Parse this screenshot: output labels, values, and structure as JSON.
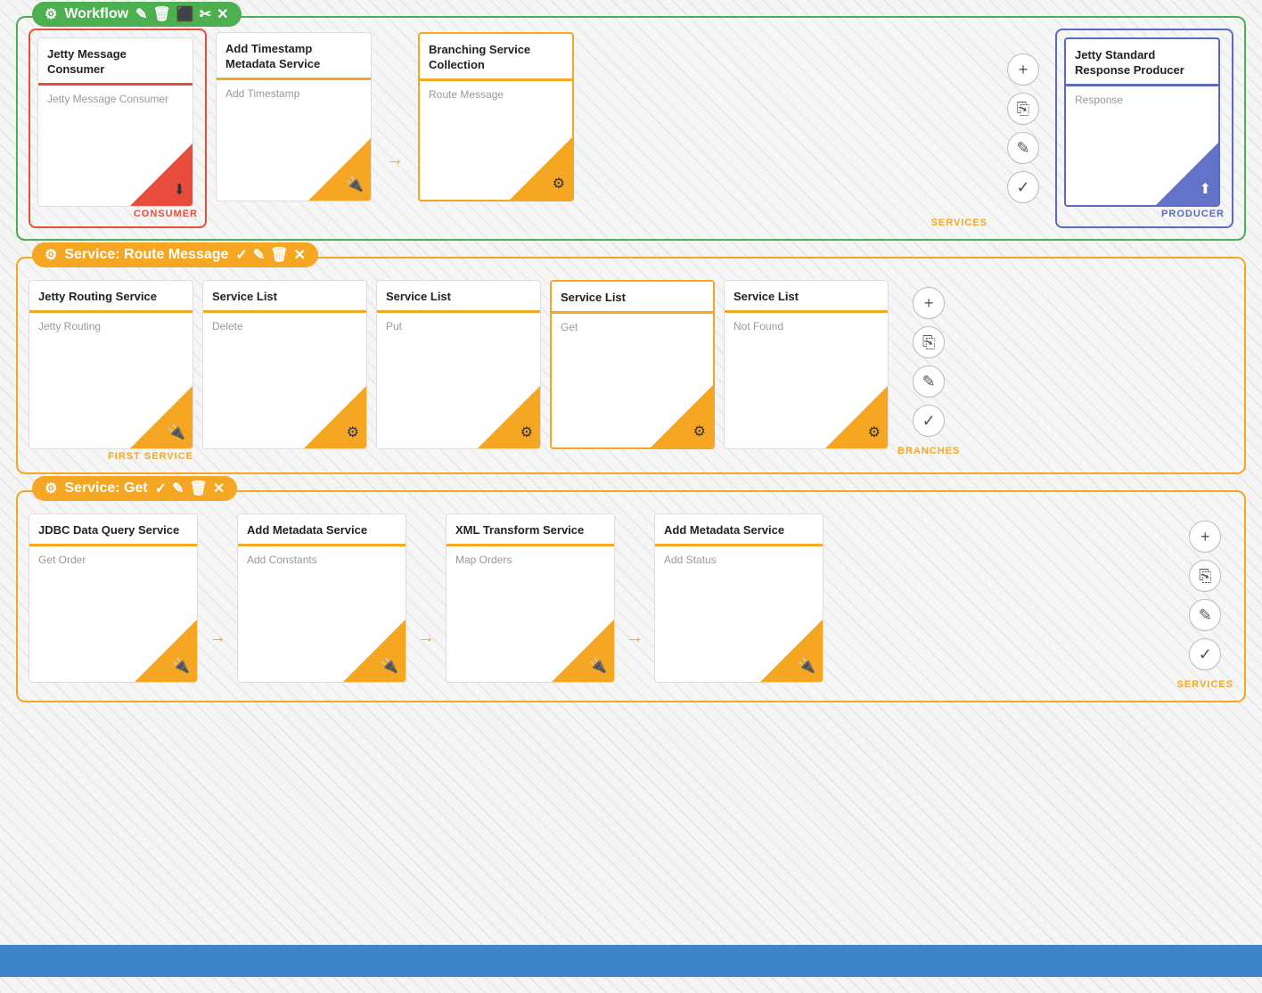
{
  "workflow": {
    "header_icon": "⚙",
    "title": "Workflow",
    "actions": [
      "✎",
      "🗑",
      "⬛",
      "✂",
      "✕"
    ],
    "consumer": {
      "label": "CONSUMER",
      "card_title": "Jetty Message Consumer",
      "card_subtitle": "Jetty Message Consumer"
    },
    "services": {
      "label": "SERVICES",
      "cards": [
        {
          "title": "Add Timestamp Metadata Service",
          "subtitle": "Add Timestamp"
        },
        {
          "title": "Branching Service Collection",
          "subtitle": "Route Message",
          "selected": true
        }
      ]
    },
    "producer": {
      "label": "PRODUCER",
      "card_title": "Jetty Standard Response Producer",
      "card_subtitle": "Response"
    }
  },
  "route_message": {
    "header_title": "Service: Route Message",
    "label": "BRANCHES",
    "first_label": "FIRST SERVICE",
    "cards": [
      {
        "title": "Jetty Routing Service",
        "subtitle": "Jetty Routing",
        "first": true
      },
      {
        "title": "Service List",
        "subtitle": "Delete"
      },
      {
        "title": "Service List",
        "subtitle": "Put"
      },
      {
        "title": "Service List",
        "subtitle": "Get",
        "bold_title": true
      },
      {
        "title": "Service List",
        "subtitle": "Not Found"
      }
    ]
  },
  "get_service": {
    "header_title": "Service: Get",
    "label": "SERVICES",
    "cards": [
      {
        "title": "JDBC Data Query Service",
        "subtitle": "Get Order"
      },
      {
        "title": "Add Metadata Service",
        "subtitle": "Add Constants"
      },
      {
        "title": "XML Transform Service",
        "subtitle": "Map Orders"
      },
      {
        "title": "Add Metadata Service",
        "subtitle": "Add Status"
      }
    ]
  },
  "side_buttons": {
    "add": "+",
    "copy": "⎘",
    "edit": "✎",
    "check": "✓"
  }
}
